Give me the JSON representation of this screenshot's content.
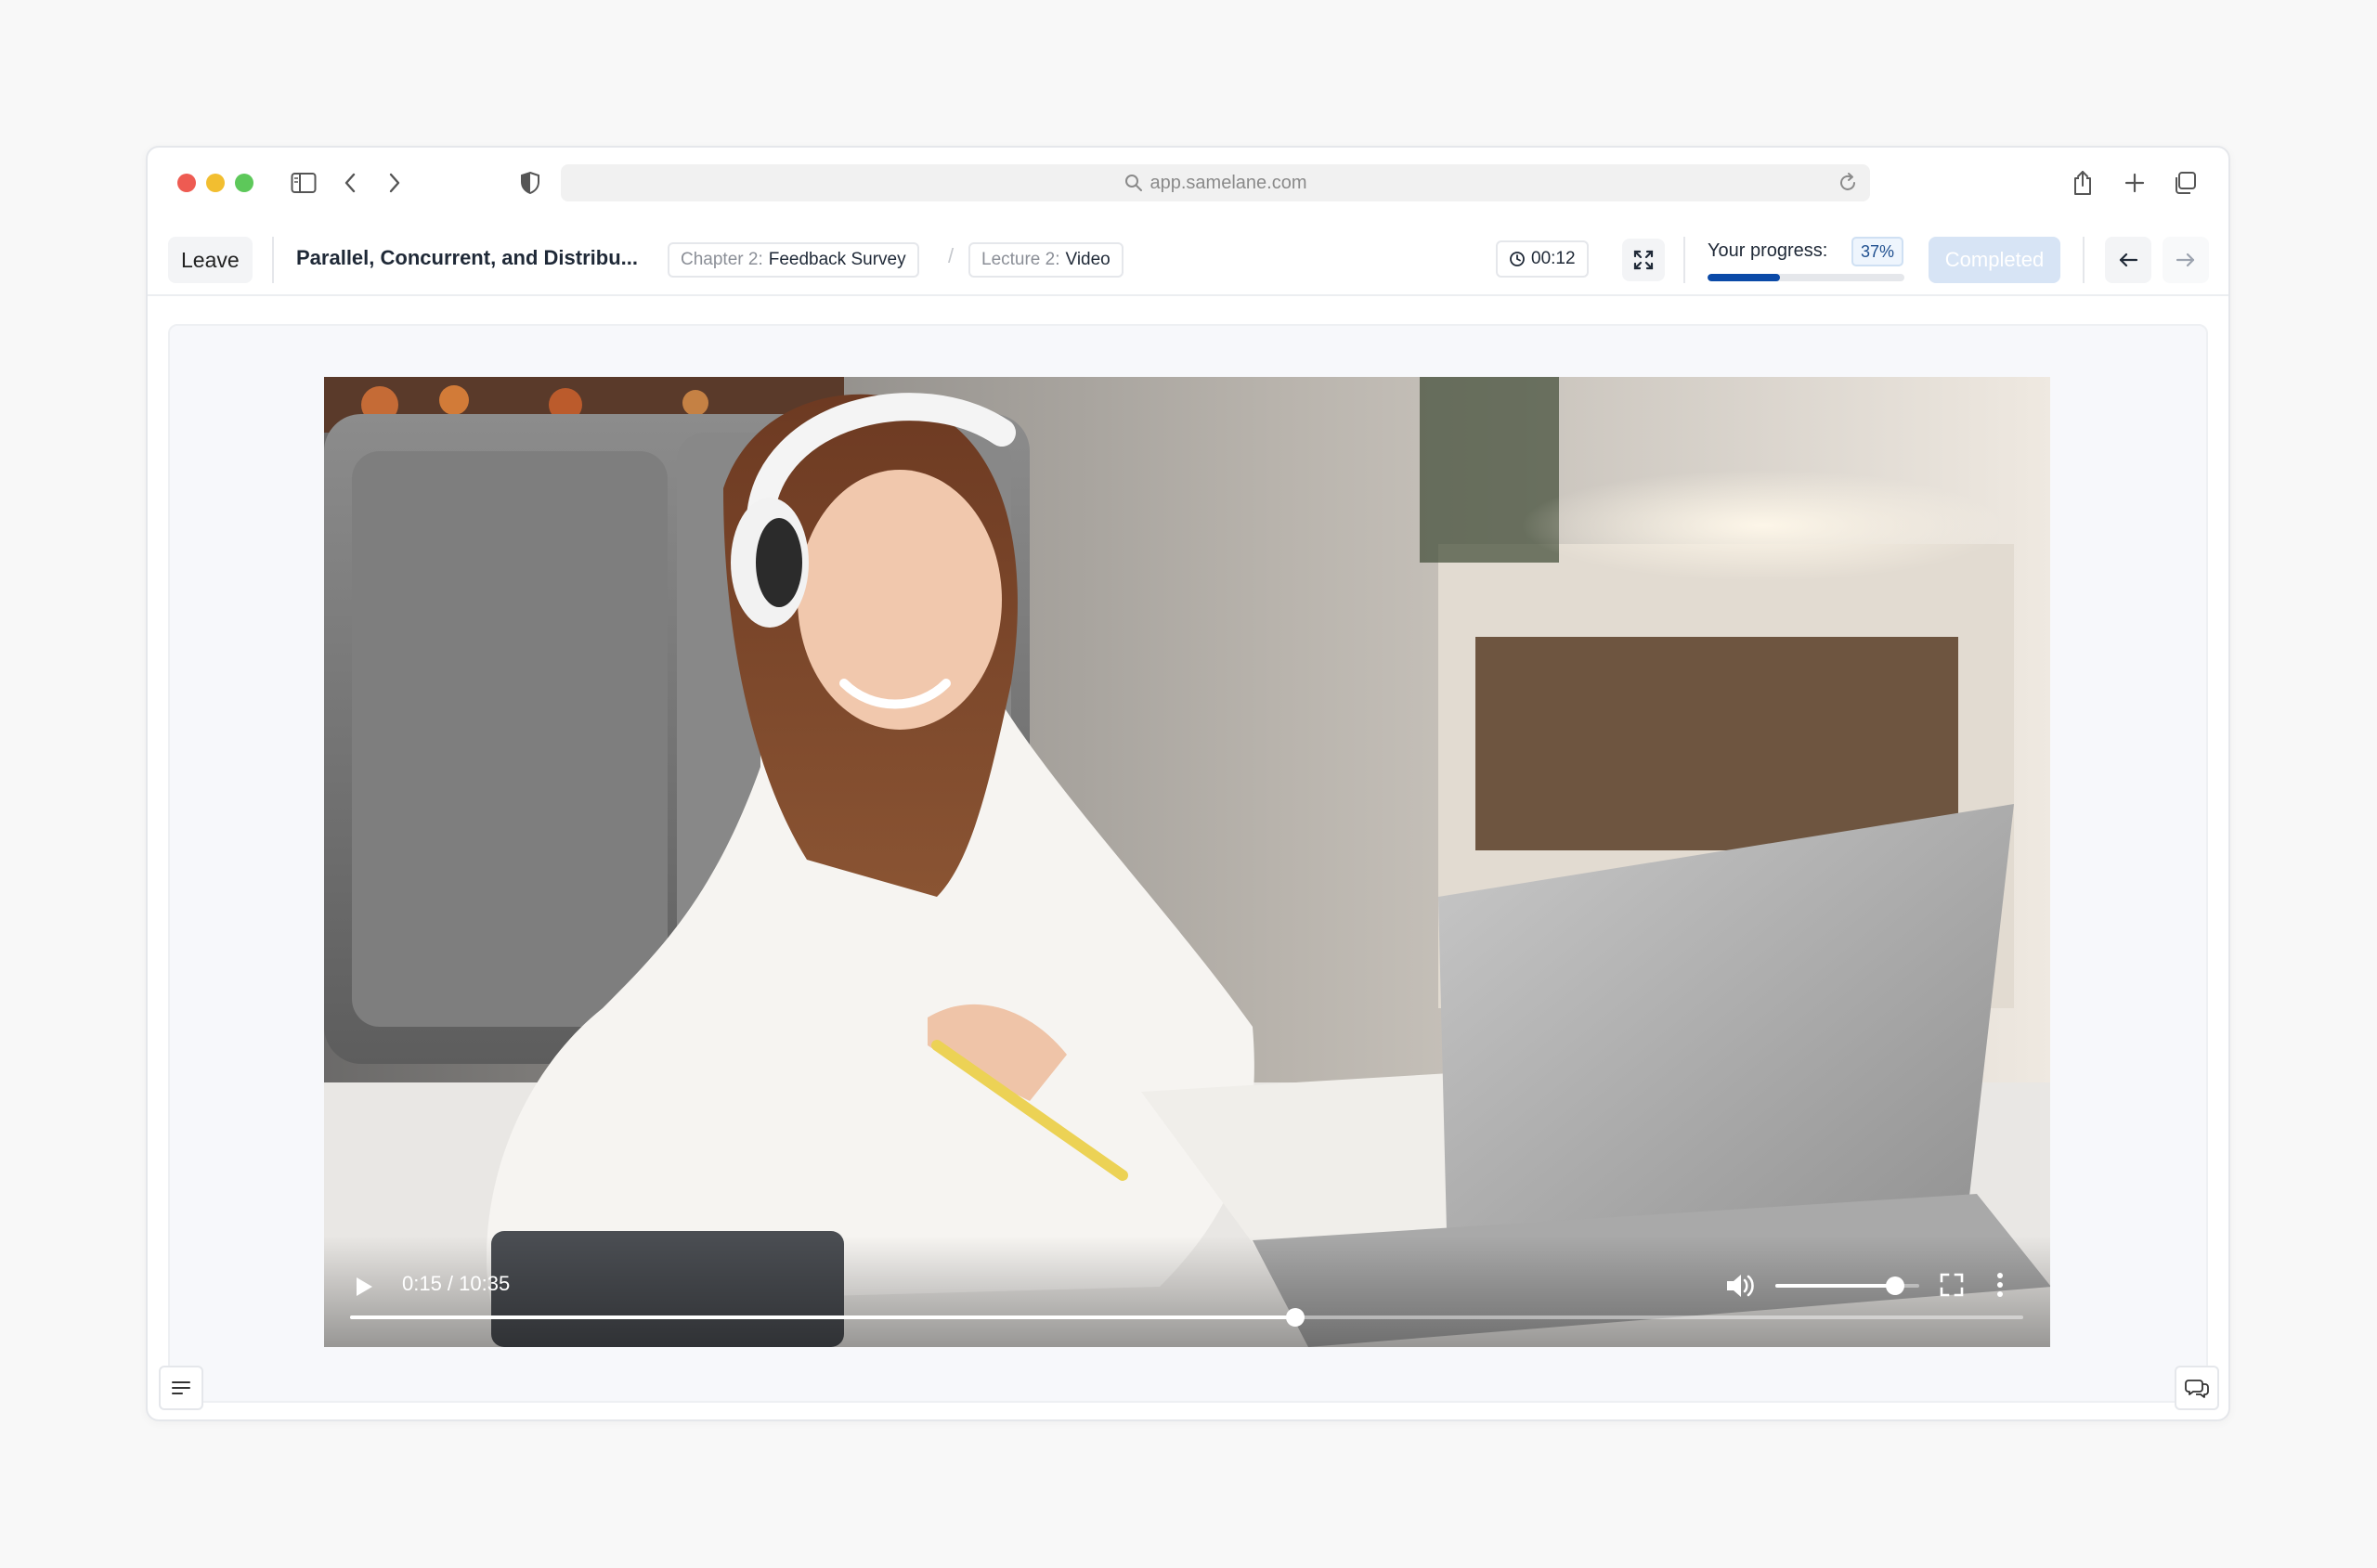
{
  "browser": {
    "url": "app.samelane.com"
  },
  "header": {
    "leave_label": "Leave",
    "course_title": "Parallel, Concurrent, and Distribu...",
    "chapter_prefix": "Chapter 2:",
    "chapter_name": "Feedback Survey",
    "separator": "/",
    "lecture_prefix": "Lecture 2:",
    "lecture_name": "Video",
    "timer": "00:12",
    "progress_label": "Your progress:",
    "progress_percent": "37%",
    "progress_value": 0.37,
    "completed_label": "Completed"
  },
  "video": {
    "time": "0:15 / 10:35",
    "playback_fraction": 0.565,
    "volume_fraction": 0.83
  },
  "colors": {
    "accent": "#0b4aa8",
    "completed_disabled": "#d7e4f5",
    "page_bg": "#f8f8f8"
  },
  "icons": [
    "sidebar-icon",
    "back-chevron-icon",
    "forward-chevron-icon",
    "shield-icon",
    "search-icon",
    "reload-icon",
    "share-icon",
    "plus-icon",
    "tabs-icon",
    "clock-icon",
    "expand-icon",
    "arrow-left-icon",
    "arrow-right-icon",
    "play-icon",
    "volume-icon",
    "fullscreen-icon",
    "more-vertical-icon",
    "list-icon",
    "chat-icon"
  ]
}
